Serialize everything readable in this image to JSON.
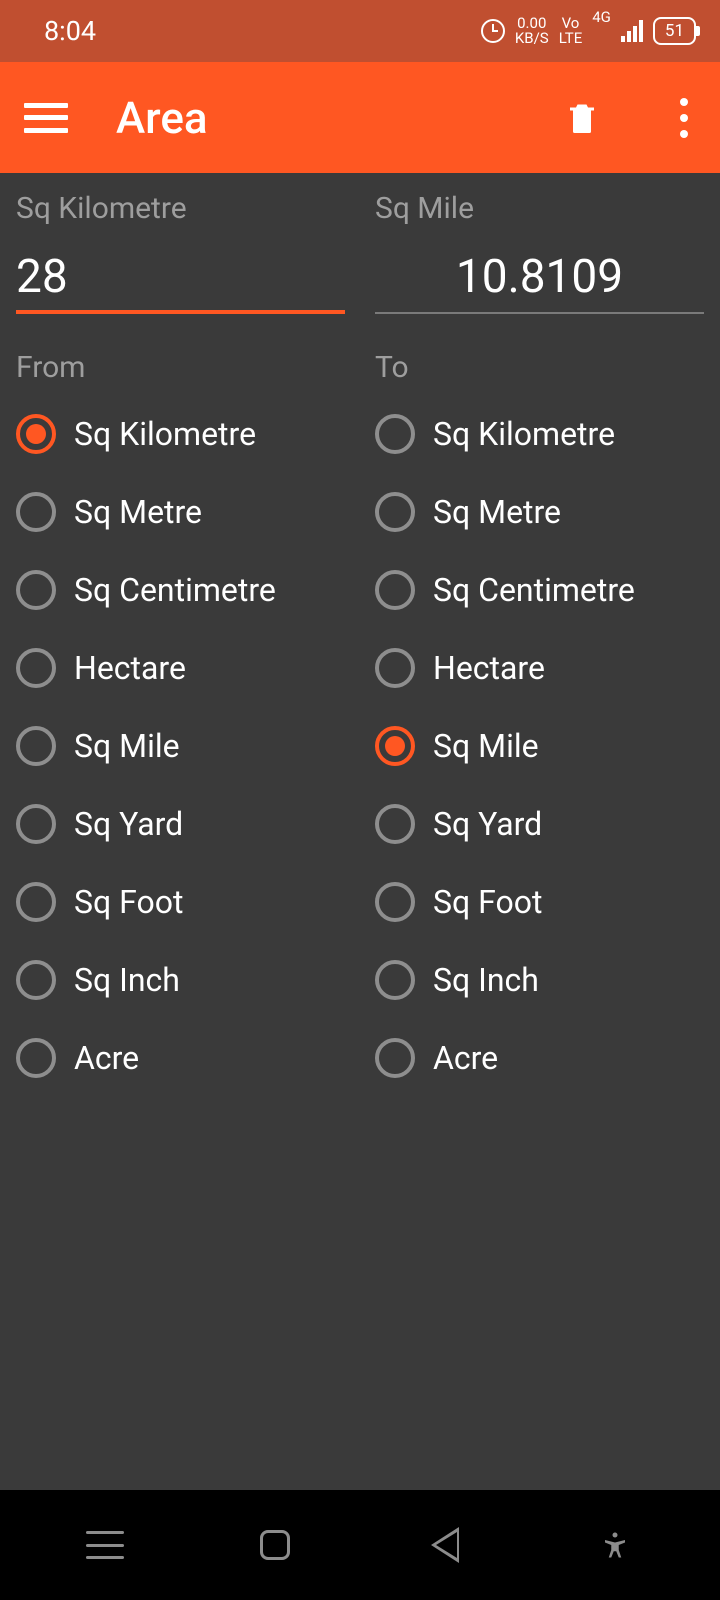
{
  "status": {
    "time": "8:04",
    "net_speed_top": "0.00",
    "net_speed_bottom": "KB/S",
    "volte_top": "Vo",
    "volte_bottom": "LTE",
    "net_type": "4G",
    "battery": "51"
  },
  "appbar": {
    "title": "Area"
  },
  "from": {
    "unit_label": "Sq Kilometre",
    "value": "28",
    "section": "From",
    "selected_index": 0
  },
  "to": {
    "unit_label": "Sq Mile",
    "value": "10.8109",
    "section": "To",
    "selected_index": 4
  },
  "units": [
    "Sq Kilometre",
    "Sq Metre",
    "Sq Centimetre",
    "Hectare",
    "Sq Mile",
    "Sq Yard",
    "Sq Foot",
    "Sq Inch",
    "Acre"
  ]
}
